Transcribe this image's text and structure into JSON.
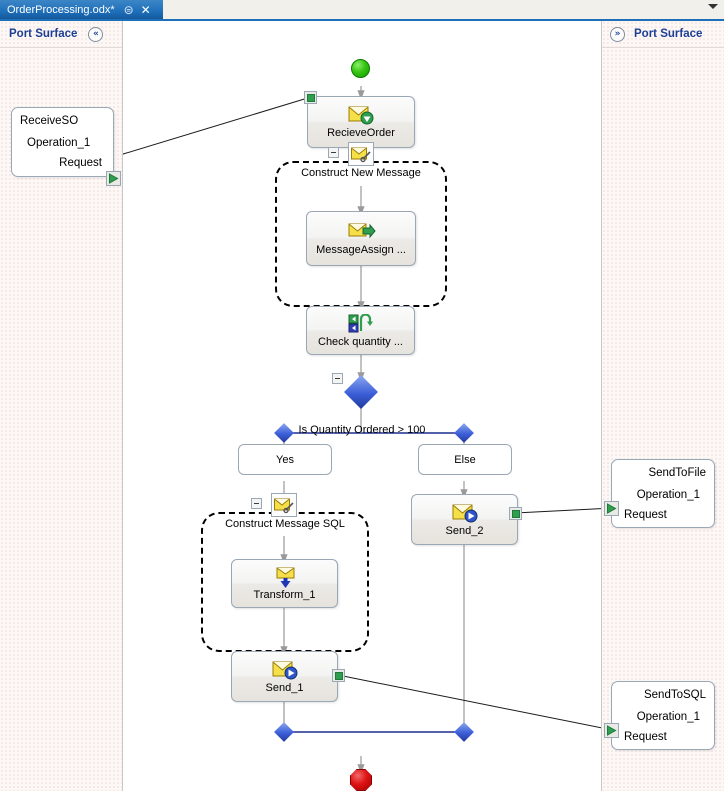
{
  "window": {
    "tab": {
      "title": "OrderProcessing.odx*",
      "pin_icon": "pin-icon",
      "close_icon": "close-icon"
    },
    "tabstrip_dropdown_icon": "chevron-down-icon"
  },
  "left_panel": {
    "title": "Port Surface",
    "collapse_icon": "chevron-double-left-icon",
    "ports": [
      {
        "name": "ReceiveSO",
        "operation": "Operation_1",
        "message": "Request",
        "connector_icon": "green-arrow-icon"
      }
    ]
  },
  "right_panel": {
    "title": "Port Surface",
    "expand_icon": "chevron-double-right-icon",
    "ports": [
      {
        "name": "SendToFile",
        "operation": "Operation_1",
        "message": "Request",
        "connector_icon": "green-arrow-icon"
      },
      {
        "name": "SendToSQL",
        "operation": "Operation_1",
        "message": "Request",
        "connector_icon": "green-arrow-icon"
      }
    ]
  },
  "orchestration": {
    "start_node": "start-circle",
    "end_node": "end-octagon",
    "shapes": {
      "receive_order": {
        "label": "RecieveOrder",
        "icon": "receive-message-icon"
      },
      "construct_new_message": {
        "label": "Construct New Message",
        "icon": "construct-message-icon",
        "collapse": "collapse-box"
      },
      "message_assignment": {
        "label": "MessageAssign ...",
        "icon": "message-assignment-icon"
      },
      "check_quantity": {
        "label": "Check  quantity ...",
        "icon": "expression-icon"
      },
      "decision": {
        "label": "Is Quantity Ordered > 100",
        "collapse": "collapse-box"
      },
      "branch_yes": {
        "label": "Yes"
      },
      "branch_else": {
        "label": "Else"
      },
      "construct_message_sql": {
        "label": "Construct Message SQL",
        "icon": "construct-message-icon",
        "collapse": "collapse-box"
      },
      "transform_1": {
        "label": "Transform_1",
        "icon": "transform-icon"
      },
      "send_1": {
        "label": "Send_1",
        "icon": "send-message-icon"
      },
      "send_2": {
        "label": "Send_2",
        "icon": "send-message-icon"
      }
    }
  },
  "colors": {
    "tab_active": "#1e6fba",
    "panel_title": "#1c3f94",
    "start": "#35c412",
    "end": "#df1414",
    "decision": "#3c5fd8",
    "connector_green": "#2f9e4f"
  }
}
